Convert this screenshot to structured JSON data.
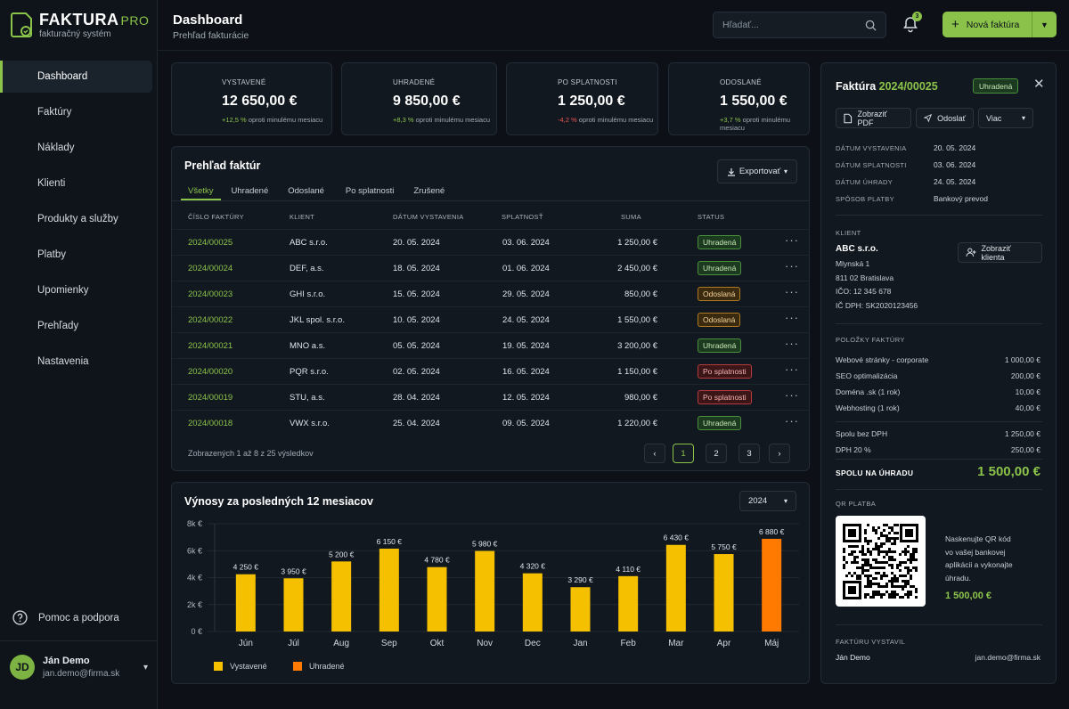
{
  "app": {
    "name": "FAKTURA",
    "suffix": "PRO",
    "subtitle": "fakturačný systém"
  },
  "nav": [
    {
      "label": "Dashboard",
      "icon": "home-icon",
      "active": true
    },
    {
      "label": "Faktúry",
      "icon": "document-icon"
    },
    {
      "label": "Náklady",
      "icon": "receipt-icon"
    },
    {
      "label": "Klienti",
      "icon": "users-icon"
    },
    {
      "label": "Produkty a služby",
      "icon": "box-icon"
    },
    {
      "label": "Platby",
      "icon": "card-icon"
    },
    {
      "label": "Upomienky",
      "icon": "bell-icon"
    },
    {
      "label": "Prehľady",
      "icon": "bar-chart-icon"
    },
    {
      "label": "Nastavenia",
      "icon": "gear-icon"
    }
  ],
  "help": "Pomoc a podpora",
  "user": {
    "initials": "JD",
    "name": "Ján Demo",
    "email": "jan.demo@firma.sk"
  },
  "header": {
    "title": "Dashboard",
    "subtitle": "Prehľad fakturácie",
    "search_placeholder": "Hľadať...",
    "notifications": "3",
    "new_invoice": "Nová faktúra"
  },
  "stats": [
    {
      "label": "VYSTAVENÉ",
      "value": "12 650,00 €",
      "change": "+12,5 %",
      "note": "oproti minulému mesiacu",
      "dir": "up",
      "icon": "document-icon",
      "color": "#8bc34a"
    },
    {
      "label": "UHRADENÉ",
      "value": "9 850,00 €",
      "change": "+8,3 %",
      "note": "oproti minulému mesiacu",
      "dir": "up",
      "icon": "check-circle-icon",
      "color": "#8bc34a"
    },
    {
      "label": "PO SPLATNOSTI",
      "value": "1 250,00 €",
      "change": "-4,2 %",
      "note": "oproti minulému mesiacu",
      "dir": "down",
      "icon": "alert-icon",
      "color": "#ef5350"
    },
    {
      "label": "ODOSLANÉ",
      "value": "1 550,00 €",
      "change": "+3,7 %",
      "note": "oproti minulému mesiacu",
      "dir": "up",
      "icon": "send-icon",
      "color": "#ff9800"
    }
  ],
  "invoices": {
    "title": "Prehľad faktúr",
    "export": "Exportovať",
    "tabs": [
      "Všetky",
      "Uhradené",
      "Odoslané",
      "Po splatnosti",
      "Zrušené"
    ],
    "columns": [
      "ČÍSLO FAKTÚRY",
      "KLIENT",
      "DÁTUM VYSTAVENIA",
      "SPLATNOSŤ",
      "SUMA",
      "STATUS"
    ],
    "rows": [
      {
        "number": "2024/00025",
        "client": "ABC s.r.o.",
        "issued": "20. 05. 2024",
        "due": "03. 06. 2024",
        "amount": "1 250,00 €",
        "status": "Uhradená",
        "kind": "paid"
      },
      {
        "number": "2024/00024",
        "client": "DEF, a.s.",
        "issued": "18. 05. 2024",
        "due": "01. 06. 2024",
        "amount": "2 450,00 €",
        "status": "Uhradená",
        "kind": "paid"
      },
      {
        "number": "2024/00023",
        "client": "GHI s.r.o.",
        "issued": "15. 05. 2024",
        "due": "29. 05. 2024",
        "amount": "850,00 €",
        "status": "Odoslaná",
        "kind": "sent"
      },
      {
        "number": "2024/00022",
        "client": "JKL spol. s.r.o.",
        "issued": "10. 05. 2024",
        "due": "24. 05. 2024",
        "amount": "1 550,00 €",
        "status": "Odoslaná",
        "kind": "sent"
      },
      {
        "number": "2024/00021",
        "client": "MNO a.s.",
        "issued": "05. 05. 2024",
        "due": "19. 05. 2024",
        "amount": "3 200,00 €",
        "status": "Uhradená",
        "kind": "paid"
      },
      {
        "number": "2024/00020",
        "client": "PQR s.r.o.",
        "issued": "02. 05. 2024",
        "due": "16. 05. 2024",
        "amount": "1 150,00 €",
        "status": "Po splatnosti",
        "kind": "over"
      },
      {
        "number": "2024/00019",
        "client": "STU, a.s.",
        "issued": "28. 04. 2024",
        "due": "12. 05. 2024",
        "amount": "980,00 €",
        "status": "Po splatnosti",
        "kind": "over"
      },
      {
        "number": "2024/00018",
        "client": "VWX s.r.o.",
        "issued": "25. 04. 2024",
        "due": "09. 05. 2024",
        "amount": "1 220,00 €",
        "status": "Uhradená",
        "kind": "paid"
      }
    ],
    "footer": "Zobrazených 1 až 8 z 25 výsledkov",
    "pages": [
      "1",
      "2",
      "3"
    ]
  },
  "revenue": {
    "title": "Výnosy za posledných 12 mesiacov",
    "year": "2024"
  },
  "chart_data": {
    "type": "bar",
    "title": "Výnosy za posledných 12 mesiacov",
    "categories": [
      "Jún",
      "Júl",
      "Aug",
      "Sep",
      "Okt",
      "Nov",
      "Dec",
      "Jan",
      "Feb",
      "Mar",
      "Apr",
      "Máj"
    ],
    "values": [
      4250,
      3950,
      5200,
      6150,
      4780,
      5980,
      4320,
      3290,
      4110,
      6430,
      5750,
      6880
    ],
    "value_labels": [
      "4 250 €",
      "3 950 €",
      "5 200 €",
      "6 150 €",
      "4 780 €",
      "5 980 €",
      "4 320 €",
      "3 290 €",
      "4 110 €",
      "6 430 €",
      "5 750 €",
      "6 880 €"
    ],
    "highlight": [
      false,
      false,
      false,
      false,
      false,
      false,
      false,
      false,
      false,
      false,
      false,
      true
    ],
    "yticks": [
      "0 €",
      "2k €",
      "4k €",
      "6k €",
      "8k €"
    ],
    "ylim": [
      0,
      8000
    ],
    "legend": [
      {
        "name": "Vystavené",
        "color": "#f5c000"
      },
      {
        "name": "Uhradené",
        "color": "#ff7a00"
      }
    ],
    "legend_position": "bottom-left",
    "colors": {
      "bar": "#f5c000",
      "highlight": "#ff7a00"
    }
  },
  "panel": {
    "title_prefix": "Faktúra",
    "number": "2024/00025",
    "status": "Uhradená",
    "buttons": {
      "pdf": "Zobraziť PDF",
      "send": "Odoslať",
      "more": "Viac"
    },
    "details": [
      {
        "k": "DÁTUM VYSTAVENIA",
        "v": "20. 05. 2024"
      },
      {
        "k": "DÁTUM SPLATNOSTI",
        "v": "03. 06. 2024"
      },
      {
        "k": "DÁTUM ÚHRADY",
        "v": "24. 05. 2024"
      },
      {
        "k": "SPÔSOB PLATBY",
        "v": "Bankový prevod"
      }
    ],
    "client_label": "KLIENT",
    "client_name": "ABC s.r.o.",
    "client_lines": [
      "Mlynská 1",
      "811 02 Bratislava",
      "IČO: 12 345 678",
      "IČ DPH: SK2020123456"
    ],
    "show_client": "Zobraziť klienta",
    "items_label": "POLOŽKY FAKTÚRY",
    "items": [
      {
        "name": "Webové stránky - corporate",
        "amount": "1 000,00 €"
      },
      {
        "name": "SEO optimalizácia",
        "amount": "200,00 €"
      },
      {
        "name": "Doména .sk (1 rok)",
        "amount": "10,00 €"
      },
      {
        "name": "Webhosting (1 rok)",
        "amount": "40,00 €"
      }
    ],
    "subtotal_label": "Spolu bez DPH",
    "subtotal": "1 250,00 €",
    "vat_label": "DPH 20 %",
    "vat": "250,00 €",
    "total_label": "SPOLU NA ÚHRADU",
    "total": "1 500,00 €",
    "qr_label": "QR PLATBA",
    "qr_text": [
      "Naskenujte QR kód",
      "vo vašej bankovej",
      "aplikácii a vykonajte",
      "úhradu."
    ],
    "qr_amount": "1 500,00 €",
    "issuer_label": "FAKTÚRU VYSTAVIL",
    "issuer_name": "Ján Demo",
    "issuer_email": "jan.demo@firma.sk"
  }
}
